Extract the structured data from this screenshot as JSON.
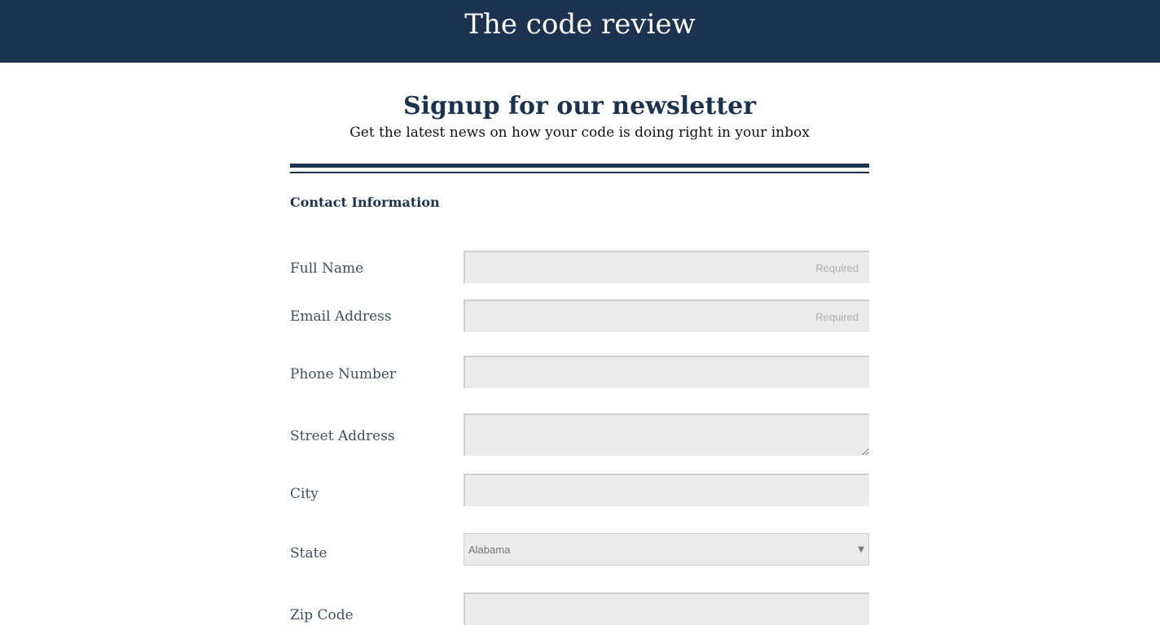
{
  "header": {
    "title": "The code review"
  },
  "form": {
    "heading": "Signup for our newsletter",
    "subheading": "Get the latest news on how your code is doing right in your inbox",
    "section_title": "Contact Information",
    "fields": {
      "full_name": {
        "label": "Full Name",
        "placeholder": "Required",
        "value": ""
      },
      "email": {
        "label": "Email Address",
        "placeholder": "Required",
        "value": ""
      },
      "phone": {
        "label": "Phone Number",
        "placeholder": "",
        "value": ""
      },
      "street": {
        "label": "Street Address",
        "placeholder": "",
        "value": ""
      },
      "city": {
        "label": "City",
        "placeholder": "",
        "value": ""
      },
      "state": {
        "label": "State",
        "selected": "Alabama"
      },
      "zip": {
        "label": "Zip Code",
        "placeholder": "",
        "value": ""
      }
    }
  },
  "icons": {
    "select_arrow": "chevron-down-icon"
  },
  "colors": {
    "brand_navy": "#1c3350",
    "field_background": "#ebebeb",
    "label_text": "#3f4f60"
  }
}
